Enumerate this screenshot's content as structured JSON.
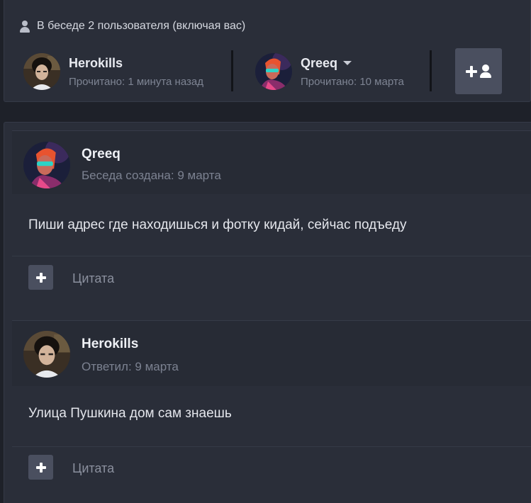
{
  "participants": {
    "header": "В беседе 2 пользователя (включая вас)",
    "users": [
      {
        "name": "Herokills",
        "read": "Прочитано: 1 минута назад"
      },
      {
        "name": "Qreeq",
        "read": "Прочитано: 10 марта"
      }
    ]
  },
  "messages": [
    {
      "author": "Qreeq",
      "meta": "Беседа создана: 9 марта",
      "text": "Пиши адрес где находишься и фотку кидай, сейчас подъеду",
      "quote_label": "Цитата"
    },
    {
      "author": "Herokills",
      "meta": "Ответил: 9 марта",
      "text": "Улица Пушкина дом сам знаешь",
      "quote_label": "Цитата"
    }
  ]
}
